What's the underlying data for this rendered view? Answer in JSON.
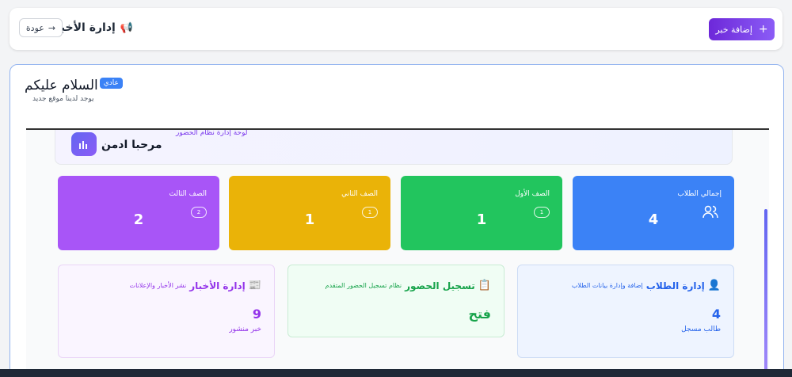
{
  "header": {
    "add_button": "إضافة خبر",
    "add_icon": "plus-icon",
    "title": "إدارة الأخبار",
    "title_icon": "megaphone-icon",
    "back_button": "عودة",
    "back_icon": "arrow-right-icon"
  },
  "news": {
    "title": "السلام عليكم",
    "badge": "عادي",
    "subtitle": "يوجد لدينا موقع جديد"
  },
  "preview": {
    "welcome_title": "مرحبا ادمن",
    "welcome_subtitle": "لوحة إدارة نظام الحضور",
    "stats": [
      {
        "label": "إجمالي الطلاب",
        "value": "4",
        "color": "#3b82f6",
        "icon": "users-icon"
      },
      {
        "label": "الصف الأول",
        "value": "1",
        "pill": "1",
        "color": "#22c55e"
      },
      {
        "label": "الصف الثاني",
        "value": "1",
        "pill": "1",
        "color": "#eab308"
      },
      {
        "label": "الصف الثالث",
        "value": "2",
        "pill": "2",
        "color": "#a855f7"
      }
    ],
    "features": [
      {
        "title": "إدارة الطلاب",
        "desc": "إضافة وإدارة بيانات الطلاب",
        "value": "4",
        "caption": "طالب مسجل",
        "color": "#2563eb",
        "icon": "user-plus-icon"
      },
      {
        "title": "تسجيل الحضور",
        "desc": "نظام تسجيل الحضور المتقدم",
        "value": "فتح",
        "color": "#16a34a",
        "icon": "clipboard-check-icon"
      },
      {
        "title": "إدارة الأخبار",
        "desc": "نشر الأخبار والإعلانات",
        "value": "9",
        "caption": "خبر منشور",
        "color": "#9333ea",
        "icon": "newspaper-icon"
      }
    ]
  }
}
